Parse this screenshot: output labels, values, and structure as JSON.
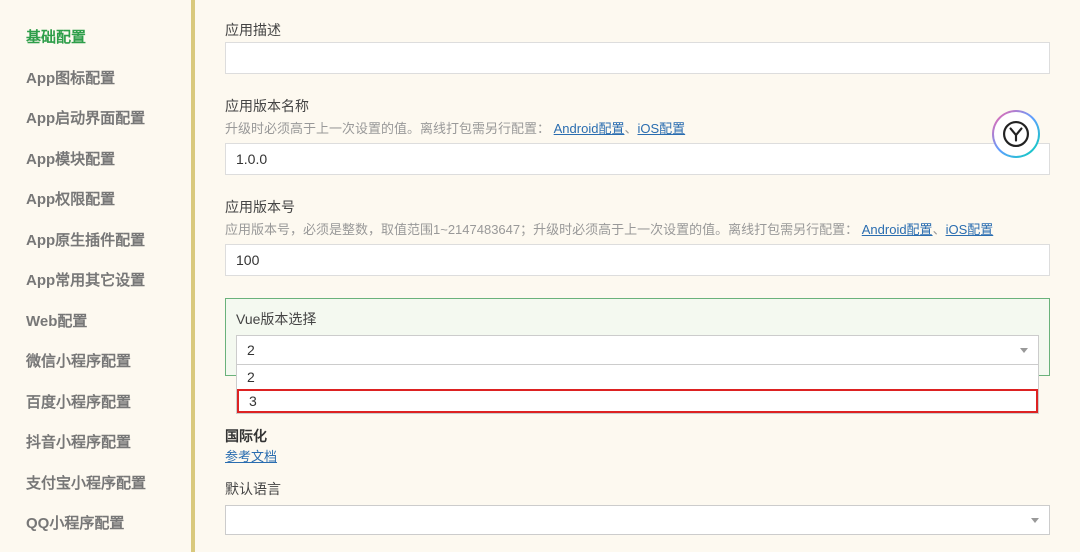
{
  "sidebar": {
    "items": [
      {
        "label": "基础配置",
        "active": true
      },
      {
        "label": "App图标配置"
      },
      {
        "label": "App启动界面配置"
      },
      {
        "label": "App模块配置"
      },
      {
        "label": "App权限配置"
      },
      {
        "label": "App原生插件配置"
      },
      {
        "label": "App常用其它设置"
      },
      {
        "label": "Web配置"
      },
      {
        "label": "微信小程序配置"
      },
      {
        "label": "百度小程序配置"
      },
      {
        "label": "抖音小程序配置"
      },
      {
        "label": "支付宝小程序配置"
      },
      {
        "label": "QQ小程序配置"
      }
    ]
  },
  "main": {
    "appDesc": {
      "label": "应用描述",
      "value": ""
    },
    "versionName": {
      "label": "应用版本名称",
      "hintPrefix": "升级时必须高于上一次设置的值。离线打包需另行配置：",
      "androidLink": "Android配置",
      "sep": "、",
      "iosLink": "iOS配置",
      "value": "1.0.0"
    },
    "versionCode": {
      "label": "应用版本号",
      "hintPrefix": "应用版本号，必须是整数，取值范围1~2147483647；升级时必须高于上一次设置的值。离线打包需另行配置：",
      "androidLink": "Android配置",
      "sep": "、",
      "iosLink": "iOS配置",
      "value": "100"
    },
    "vue": {
      "label": "Vue版本选择",
      "selected": "2",
      "options": [
        "2",
        "3"
      ]
    },
    "i18n": {
      "label": "国际化",
      "docLink": "参考文档"
    },
    "defaultLang": {
      "label": "默认语言",
      "value": ""
    }
  }
}
